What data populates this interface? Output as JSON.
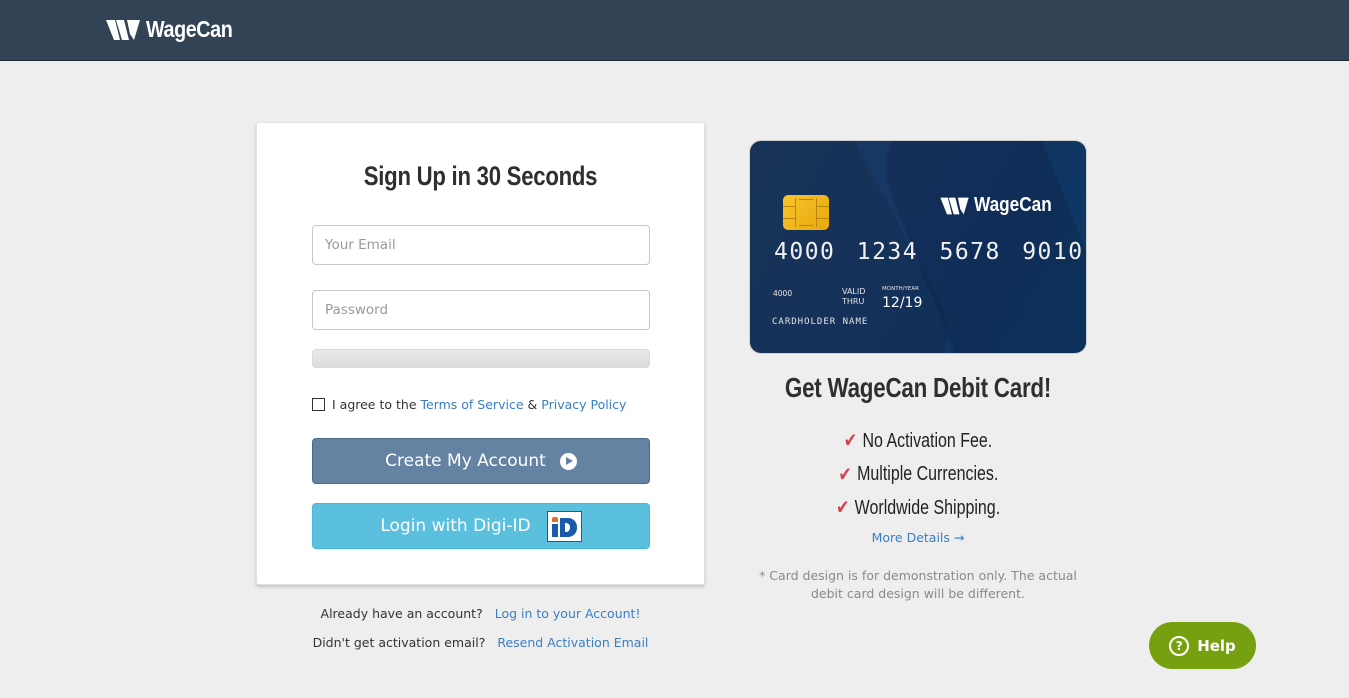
{
  "header": {
    "brand": "WageCan",
    "logo_icon": "wagecan-w-logo"
  },
  "signup": {
    "title": "Sign Up in 30 Seconds",
    "email_placeholder": "Your Email",
    "email_value": "",
    "password_placeholder": "Password",
    "password_value": "",
    "password_strength": 0,
    "agree_prefix": "I agree to the",
    "terms_link": "Terms of Service",
    "ampersand": "&",
    "privacy_link": "Privacy Policy",
    "agree_checked": false,
    "create_button": "Create My Account",
    "create_icon": "play-circle-icon",
    "digi_button": "Login with Digi-ID",
    "digi_icon": "digi-id-logo"
  },
  "below": {
    "login_prompt": "Already have an account?",
    "login_link": "Log in to your Account!",
    "resend_prompt": "Didn't get activation email?",
    "resend_link": "Resend Activation Email"
  },
  "debit_card": {
    "brand": "WageCan",
    "number": "4000 1234 5678 9010",
    "short_number": "4000",
    "valid_thru": "VALID\nTHRU",
    "month_year_label": "MONTH/YEAR",
    "expiry": "12/19",
    "cardholder": "CARDHOLDER NAME"
  },
  "promo": {
    "title": "Get WageCan Debit Card!",
    "features": [
      {
        "icon": "check-icon",
        "text": "No Activation Fee."
      },
      {
        "icon": "check-icon",
        "text": "Multiple Currencies."
      },
      {
        "icon": "check-icon",
        "text": "Worldwide Shipping."
      }
    ],
    "more_details": "More Details →",
    "disclaimer": "* Card design is for demonstration only. The actual debit card design will be different."
  },
  "help": {
    "label": "Help",
    "icon": "question-circle-icon"
  },
  "colors": {
    "header_bg": "#314355",
    "page_bg": "#eeeeee",
    "link": "#3a7fc4",
    "create_button": "#6482a1",
    "digi_button": "#5bc0de",
    "check": "#d9404e",
    "help_button": "#77a010"
  }
}
